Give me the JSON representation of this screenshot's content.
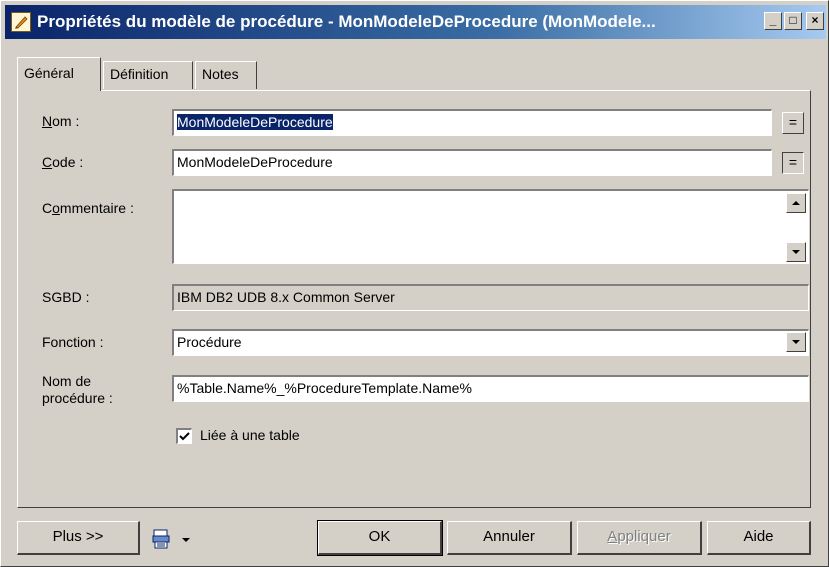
{
  "window": {
    "title": "Propriétés du modèle de procédure - MonModeleDeProcedure (MonModele...",
    "minimize_glyph": "_",
    "maximize_glyph": "□",
    "close_glyph": "×"
  },
  "tabs": [
    {
      "label": "Général",
      "active": true
    },
    {
      "label": "Définition",
      "active": false
    },
    {
      "label": "Notes",
      "active": false
    }
  ],
  "form": {
    "nom_label_u": "N",
    "nom_label_rest": "om :",
    "nom_value": "MonModeleDeProcedure",
    "code_label_u": "C",
    "code_label_rest": "ode :",
    "code_value": "MonModeleDeProcedure",
    "commentaire_label_pre": "C",
    "commentaire_label_u": "o",
    "commentaire_label_rest": "mmentaire :",
    "commentaire_value": "",
    "sgbd_label": "SGBD :",
    "sgbd_value": "IBM DB2 UDB 8.x Common Server",
    "fonction_label": "Fonction :",
    "fonction_value": "Procédure",
    "nom_procedure_label_1": "Nom de",
    "nom_procedure_label_2": "procédure :",
    "nom_procedure_value": "%Table.Name%_%ProcedureTemplate.Name%",
    "liee_label": "Liée à une table",
    "liee_checked": true,
    "equals_glyph": "="
  },
  "footer": {
    "plus": "Plus >>",
    "ok": "OK",
    "annuler": "Annuler",
    "appliquer_u": "A",
    "appliquer_rest": "ppliquer",
    "aide": "Aide"
  }
}
